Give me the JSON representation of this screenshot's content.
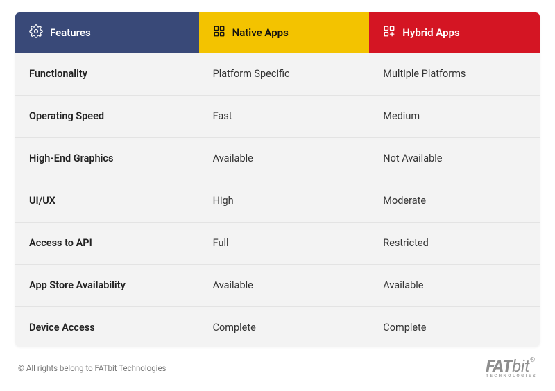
{
  "headers": {
    "features": "Features",
    "native": "Native Apps",
    "hybrid": "Hybrid Apps"
  },
  "rows": [
    {
      "feature": "Functionality",
      "native": "Platform Specific",
      "hybrid": "Multiple Platforms"
    },
    {
      "feature": "Operating Speed",
      "native": "Fast",
      "hybrid": "Medium"
    },
    {
      "feature": "High-End Graphics",
      "native": "Available",
      "hybrid": "Not Available"
    },
    {
      "feature": "UI/UX",
      "native": "High",
      "hybrid": "Moderate"
    },
    {
      "feature": "Access to API",
      "native": "Full",
      "hybrid": "Restricted"
    },
    {
      "feature": "App Store Availability",
      "native": "Available",
      "hybrid": "Available"
    },
    {
      "feature": "Device Access",
      "native": "Complete",
      "hybrid": "Complete"
    }
  ],
  "footer": {
    "copyright": "© All rights belong to FATbit Technologies",
    "logo_main": "FAT",
    "logo_sub": "bit",
    "logo_reg": "®",
    "logo_tag": "TECHNOLOGIES"
  }
}
